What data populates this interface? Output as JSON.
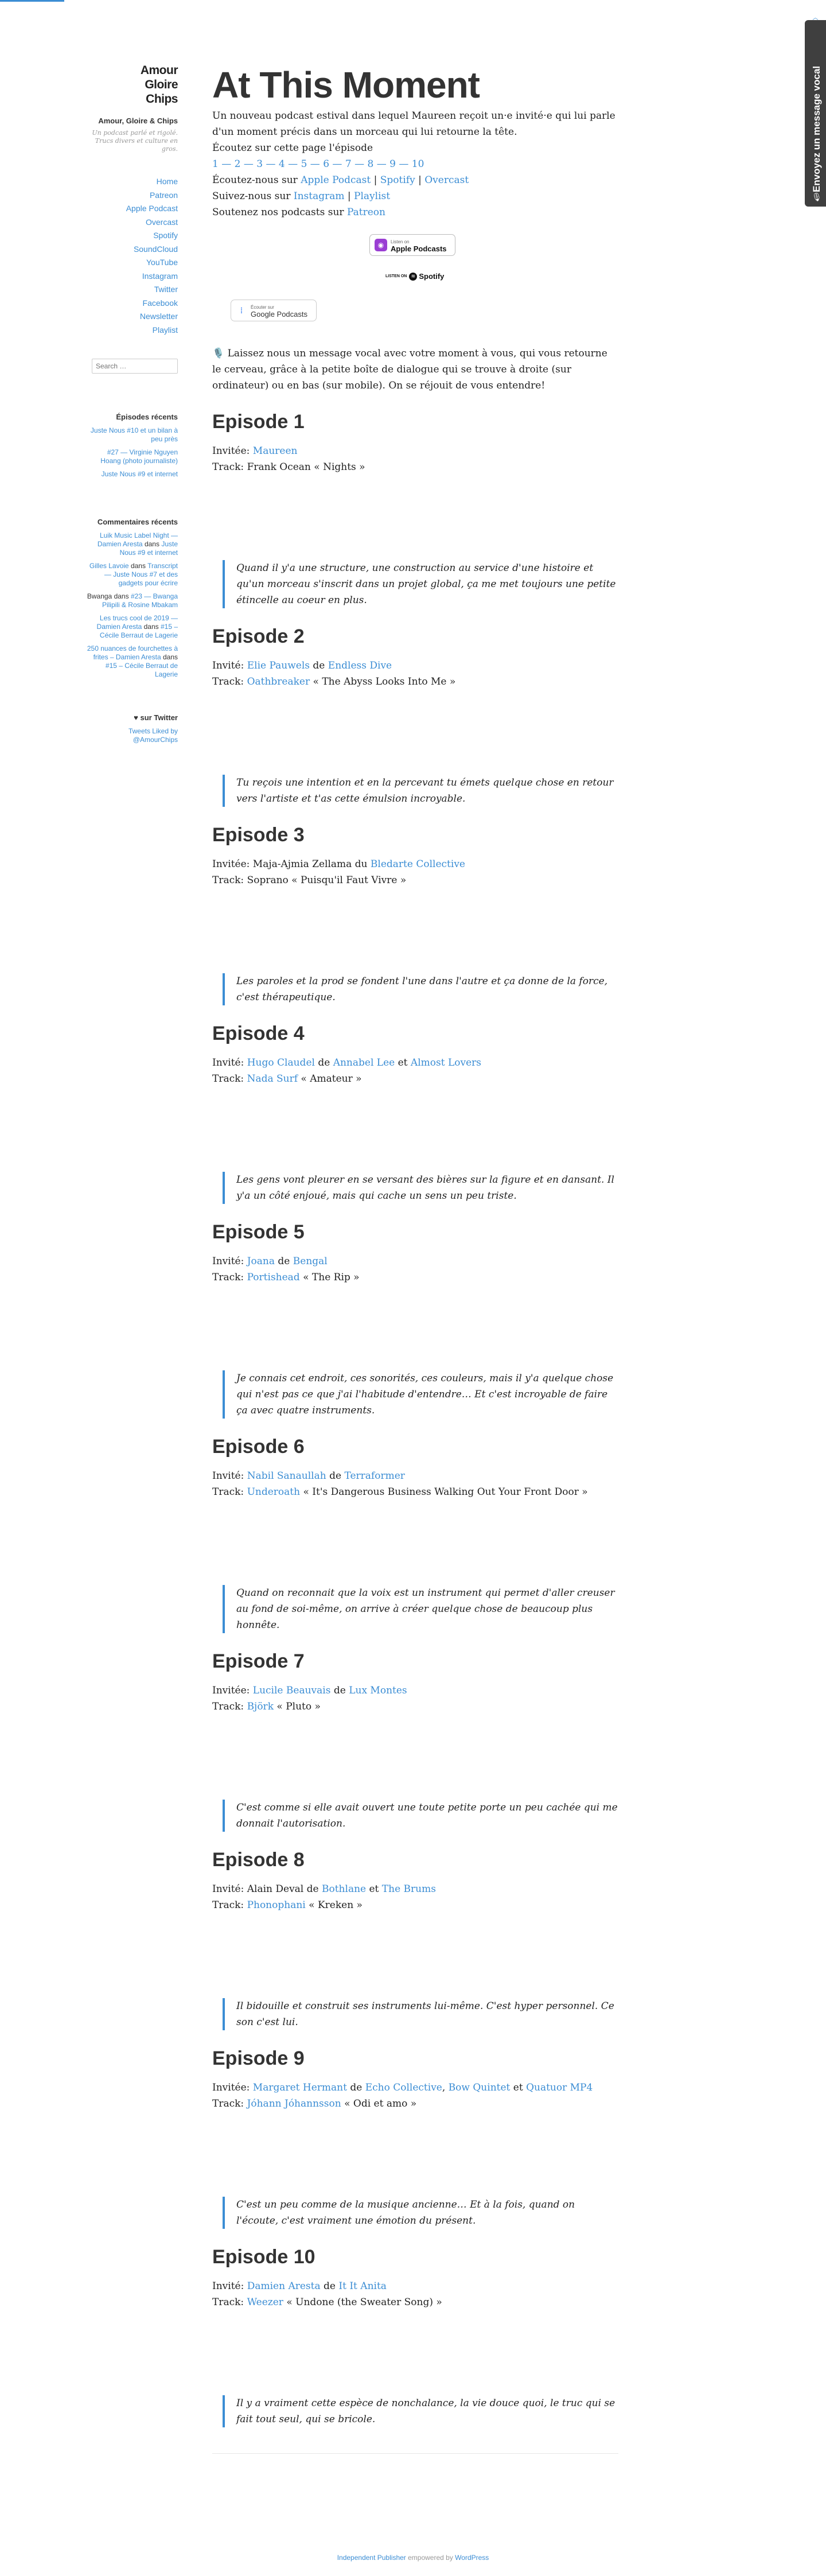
{
  "site": {
    "title": "Amour Gloire Chips",
    "name": "Amour, Gloire & Chips",
    "description": "Un podcast parlé et rigolé. Trucs divers et culture en gros."
  },
  "nav": [
    "Home",
    "Patreon",
    "Apple Podcast",
    "Overcast",
    "Spotify",
    "SoundCloud",
    "YouTube",
    "Instagram",
    "Twitter",
    "Facebook",
    "Newsletter",
    "Playlist"
  ],
  "search": {
    "placeholder": "Search …"
  },
  "recent_posts": {
    "title": "Épisodes récents",
    "items": [
      "Juste Nous #10 et un bilan à peu près",
      "#27 — Virginie Nguyen Hoang (photo journaliste)",
      "Juste Nous #9 et internet"
    ]
  },
  "recent_comments": {
    "title": "Commentaires récents",
    "items": [
      {
        "author": "Luik Music Label Night — Damien Aresta",
        "sep": "dans",
        "post": "Juste Nous #9 et internet"
      },
      {
        "author": "Gilles Lavoie",
        "sep": "dans",
        "post": "Transcript — Juste Nous #7 et des gadgets pour écrire"
      },
      {
        "author": "Bwanga",
        "sep": "dans",
        "post": "#23 — Bwanga Pilipili & Rosine Mbakam"
      },
      {
        "author": "Les trucs cool de 2019 — Damien Aresta",
        "sep": "dans",
        "post": "#15 – Cécile Berraut de Lagerie"
      },
      {
        "author": "250 nuances de fourchettes à frites – Damien Aresta",
        "sep": "dans",
        "post": "#15 – Cécile Berraut de Lagerie"
      }
    ]
  },
  "twitter": {
    "title": "♥ sur Twitter",
    "link": "Tweets Liked by @AmourChips"
  },
  "page": {
    "title": "At This Moment",
    "intro": "Un nouveau podcast estival dans lequel Maureen reçoit un·e invité·e qui lui parle d'un moment précis dans un morceau qui lui retourne la tête.",
    "listen_label": "Écoutez sur cette page l'épisode",
    "episode_numbers": [
      "1",
      "2",
      "3",
      "4",
      "5",
      "6",
      "7",
      "8",
      "9",
      "10"
    ],
    "listen_us": "Écoutez-nous sur",
    "listen_links": [
      "Apple Podcast",
      "Spotify",
      "Overcast"
    ],
    "follow_us": "Suivez-nous sur",
    "follow_links": [
      "Instagram",
      "Playlist"
    ],
    "support_us": "Soutenez nos podcasts sur",
    "support_link": "Patreon",
    "badge_apple": {
      "small": "Listen on",
      "big": "Apple Podcasts"
    },
    "badge_spotify": {
      "small": "LISTEN ON",
      "big": "Spotify"
    },
    "badge_google": {
      "small": "Écouter sur",
      "big": "Google Podcasts"
    },
    "voice_message": "🎙️ Laissez nous un message vocal avec votre moment à vous, qui vous retourne le cerveau, grâce à la petite boîte de dialogue qui se trouve à droite (sur ordinateur) ou en bas (sur mobile). On se réjouit de vous entendre!"
  },
  "episodes": [
    {
      "title": "Episode 1",
      "guest_label": "Invitée:",
      "guest": [
        {
          "t": "Maureen",
          "link": true
        }
      ],
      "track_label": "Track:",
      "track": [
        {
          "t": "Frank Ocean « Nights »",
          "link": false
        }
      ],
      "quote": "Quand il y'a une structure, une construction au service d'une histoire et qu'un morceau s'inscrit dans un projet global, ça me met toujours une petite étincelle au coeur en plus."
    },
    {
      "title": "Episode 2",
      "guest_label": "Invité:",
      "guest": [
        {
          "t": "Elie Pauwels",
          "link": true
        },
        {
          "t": " de ",
          "link": false
        },
        {
          "t": "Endless Dive",
          "link": true
        }
      ],
      "track_label": "Track:",
      "track": [
        {
          "t": "Oathbreaker",
          "link": true
        },
        {
          "t": " « The Abyss Looks Into Me »",
          "link": false
        }
      ],
      "quote": "Tu reçois une intention et en la percevant tu émets quelque chose en retour vers l'artiste et t'as cette émulsion incroyable."
    },
    {
      "title": "Episode 3",
      "guest_label": "Invitée:",
      "guest": [
        {
          "t": "Maja-Ajmia Zellama du ",
          "link": false
        },
        {
          "t": "Bledarte Collective",
          "link": true
        }
      ],
      "track_label": "Track:",
      "track": [
        {
          "t": "Soprano « Puisqu'il Faut Vivre »",
          "link": false
        }
      ],
      "quote": "Les paroles et la prod se fondent l'une dans l'autre et ça donne de la force, c'est thérapeutique."
    },
    {
      "title": "Episode 4",
      "guest_label": "Invité:",
      "guest": [
        {
          "t": "Hugo Claudel",
          "link": true
        },
        {
          "t": " de ",
          "link": false
        },
        {
          "t": "Annabel Lee",
          "link": true
        },
        {
          "t": " et ",
          "link": false
        },
        {
          "t": "Almost Lovers",
          "link": true
        }
      ],
      "track_label": "Track:",
      "track": [
        {
          "t": "Nada Surf",
          "link": true
        },
        {
          "t": " « Amateur »",
          "link": false
        }
      ],
      "quote": "Les gens vont pleurer en se versant des bières sur la figure et en dansant. Il y'a un côté enjoué, mais qui cache un sens un peu triste."
    },
    {
      "title": "Episode 5",
      "guest_label": "Invité:",
      "guest": [
        {
          "t": "Joana",
          "link": true
        },
        {
          "t": " de ",
          "link": false
        },
        {
          "t": "Bengal",
          "link": true
        }
      ],
      "track_label": "Track:",
      "track": [
        {
          "t": "Portishead",
          "link": true
        },
        {
          "t": " « The Rip »",
          "link": false
        }
      ],
      "quote": "Je connais cet endroit, ces sonorités, ces couleurs, mais il y'a quelque chose qui n'est pas ce que j'ai l'habitude d'entendre… Et c'est incroyable de faire ça avec quatre instruments."
    },
    {
      "title": "Episode 6",
      "guest_label": "Invité:",
      "guest": [
        {
          "t": "Nabil Sanaullah",
          "link": true
        },
        {
          "t": " de ",
          "link": false
        },
        {
          "t": "Terraformer",
          "link": true
        }
      ],
      "track_label": "Track:",
      "track": [
        {
          "t": "Underoath",
          "link": true
        },
        {
          "t": " « It's Dangerous Business Walking Out Your Front Door »",
          "link": false
        }
      ],
      "quote": "Quand on reconnait que la voix est un instrument qui permet d'aller creuser au fond de soi-même, on arrive à créer quelque chose de beaucoup plus honnête."
    },
    {
      "title": "Episode 7",
      "guest_label": "Invitée:",
      "guest": [
        {
          "t": "Lucile Beauvais",
          "link": true
        },
        {
          "t": " de ",
          "link": false
        },
        {
          "t": "Lux Montes",
          "link": true
        }
      ],
      "track_label": "Track:",
      "track": [
        {
          "t": "Björk",
          "link": true
        },
        {
          "t": " « Pluto »",
          "link": false
        }
      ],
      "quote": "C'est comme si elle avait ouvert une toute petite porte un peu cachée qui me donnait l'autorisation."
    },
    {
      "title": "Episode 8",
      "guest_label": "Invité:",
      "guest": [
        {
          "t": "Alain Deval de ",
          "link": false
        },
        {
          "t": "Bothlane",
          "link": true
        },
        {
          "t": " et ",
          "link": false
        },
        {
          "t": "The Brums",
          "link": true
        }
      ],
      "track_label": "Track:",
      "track": [
        {
          "t": "Phonophani",
          "link": true
        },
        {
          "t": " « Kreken »",
          "link": false
        }
      ],
      "quote": "Il bidouille et construit ses instruments lui-même. C'est hyper personnel. Ce son c'est lui."
    },
    {
      "title": "Episode 9",
      "guest_label": "Invitée:",
      "guest": [
        {
          "t": "Margaret Hermant",
          "link": true
        },
        {
          "t": " de ",
          "link": false
        },
        {
          "t": "Echo Collective",
          "link": true
        },
        {
          "t": ", ",
          "link": false
        },
        {
          "t": "Bow Quintet",
          "link": true
        },
        {
          "t": " et ",
          "link": false
        },
        {
          "t": "Quatuor MP4",
          "link": true
        }
      ],
      "track_label": "Track:",
      "track": [
        {
          "t": "Jóhann Jóhannsson",
          "link": true
        },
        {
          "t": " « Odi et amo »",
          "link": false
        }
      ],
      "quote": "C'est un peu comme de la musique ancienne… Et à la fois, quand on l'écoute, c'est vraiment une émotion du présent."
    },
    {
      "title": "Episode 10",
      "guest_label": "Invité:",
      "guest": [
        {
          "t": "Damien Aresta",
          "link": true
        },
        {
          "t": " de ",
          "link": false
        },
        {
          "t": "It It Anita",
          "link": true
        }
      ],
      "track_label": "Track:",
      "track": [
        {
          "t": "Weezer",
          "link": true
        },
        {
          "t": " « Undone (the Sweater Song) »",
          "link": false
        }
      ],
      "quote": "Il y a vraiment cette espèce de nonchalance, la vie douce quoi, le truc qui se fait tout seul, qui se bricole."
    }
  ],
  "footer": {
    "theme": "Independent Publisher",
    "middle": " empowered by ",
    "wp": "WordPress"
  },
  "voice_tab": {
    "label": "Envoyez un message vocal",
    "icon": "microphone-icon",
    "top_icon": "chevron-up-icon"
  }
}
